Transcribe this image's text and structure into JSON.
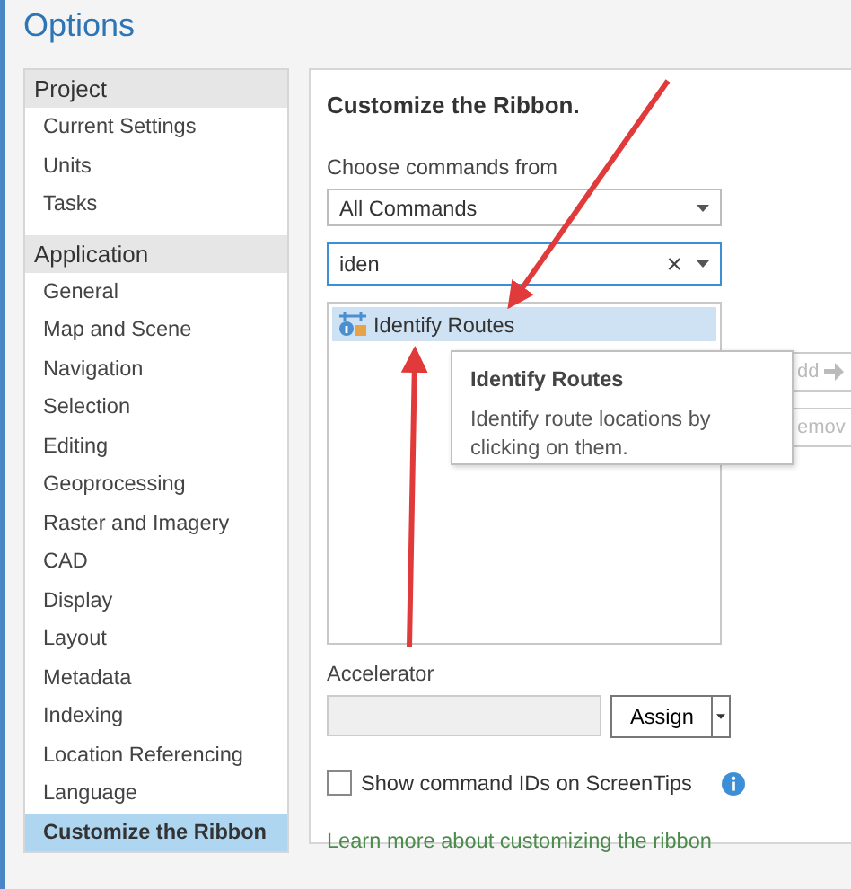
{
  "window": {
    "title": "Options"
  },
  "sidebar": {
    "groups": [
      {
        "label": "Project",
        "items": [
          {
            "label": "Current Settings",
            "selected": false
          },
          {
            "label": "Units",
            "selected": false
          },
          {
            "label": "Tasks",
            "selected": false
          }
        ]
      },
      {
        "label": "Application",
        "items": [
          {
            "label": "General",
            "selected": false
          },
          {
            "label": "Map and Scene",
            "selected": false
          },
          {
            "label": "Navigation",
            "selected": false
          },
          {
            "label": "Selection",
            "selected": false
          },
          {
            "label": "Editing",
            "selected": false
          },
          {
            "label": "Geoprocessing",
            "selected": false
          },
          {
            "label": "Raster and Imagery",
            "selected": false
          },
          {
            "label": "CAD",
            "selected": false
          },
          {
            "label": "Display",
            "selected": false
          },
          {
            "label": "Layout",
            "selected": false
          },
          {
            "label": "Metadata",
            "selected": false
          },
          {
            "label": "Indexing",
            "selected": false
          },
          {
            "label": "Location Referencing",
            "selected": false
          },
          {
            "label": "Language",
            "selected": false
          },
          {
            "label": "Customize the Ribbon",
            "selected": true
          }
        ]
      }
    ]
  },
  "panel": {
    "heading": "Customize the Ribbon.",
    "commands_label": "Choose commands from",
    "commands_dropdown": {
      "value": "All Commands"
    },
    "search": {
      "value": "iden",
      "clear": "×"
    },
    "command_list": [
      {
        "label": "Identify Routes",
        "selected": true
      }
    ],
    "tooltip": {
      "title": "Identify Routes",
      "text": "Identify route locations by clicking on them."
    },
    "side_buttons": [
      {
        "label": "dd",
        "disabled": true,
        "kind": "add"
      },
      {
        "label": "emov",
        "disabled": true,
        "kind": "remove"
      }
    ],
    "accelerator": {
      "label": "Accelerator",
      "button": "Assign"
    },
    "show_ids": {
      "label": "Show command IDs on ScreenTips",
      "checked": false
    },
    "link": "Learn more about customizing the ribbon"
  }
}
